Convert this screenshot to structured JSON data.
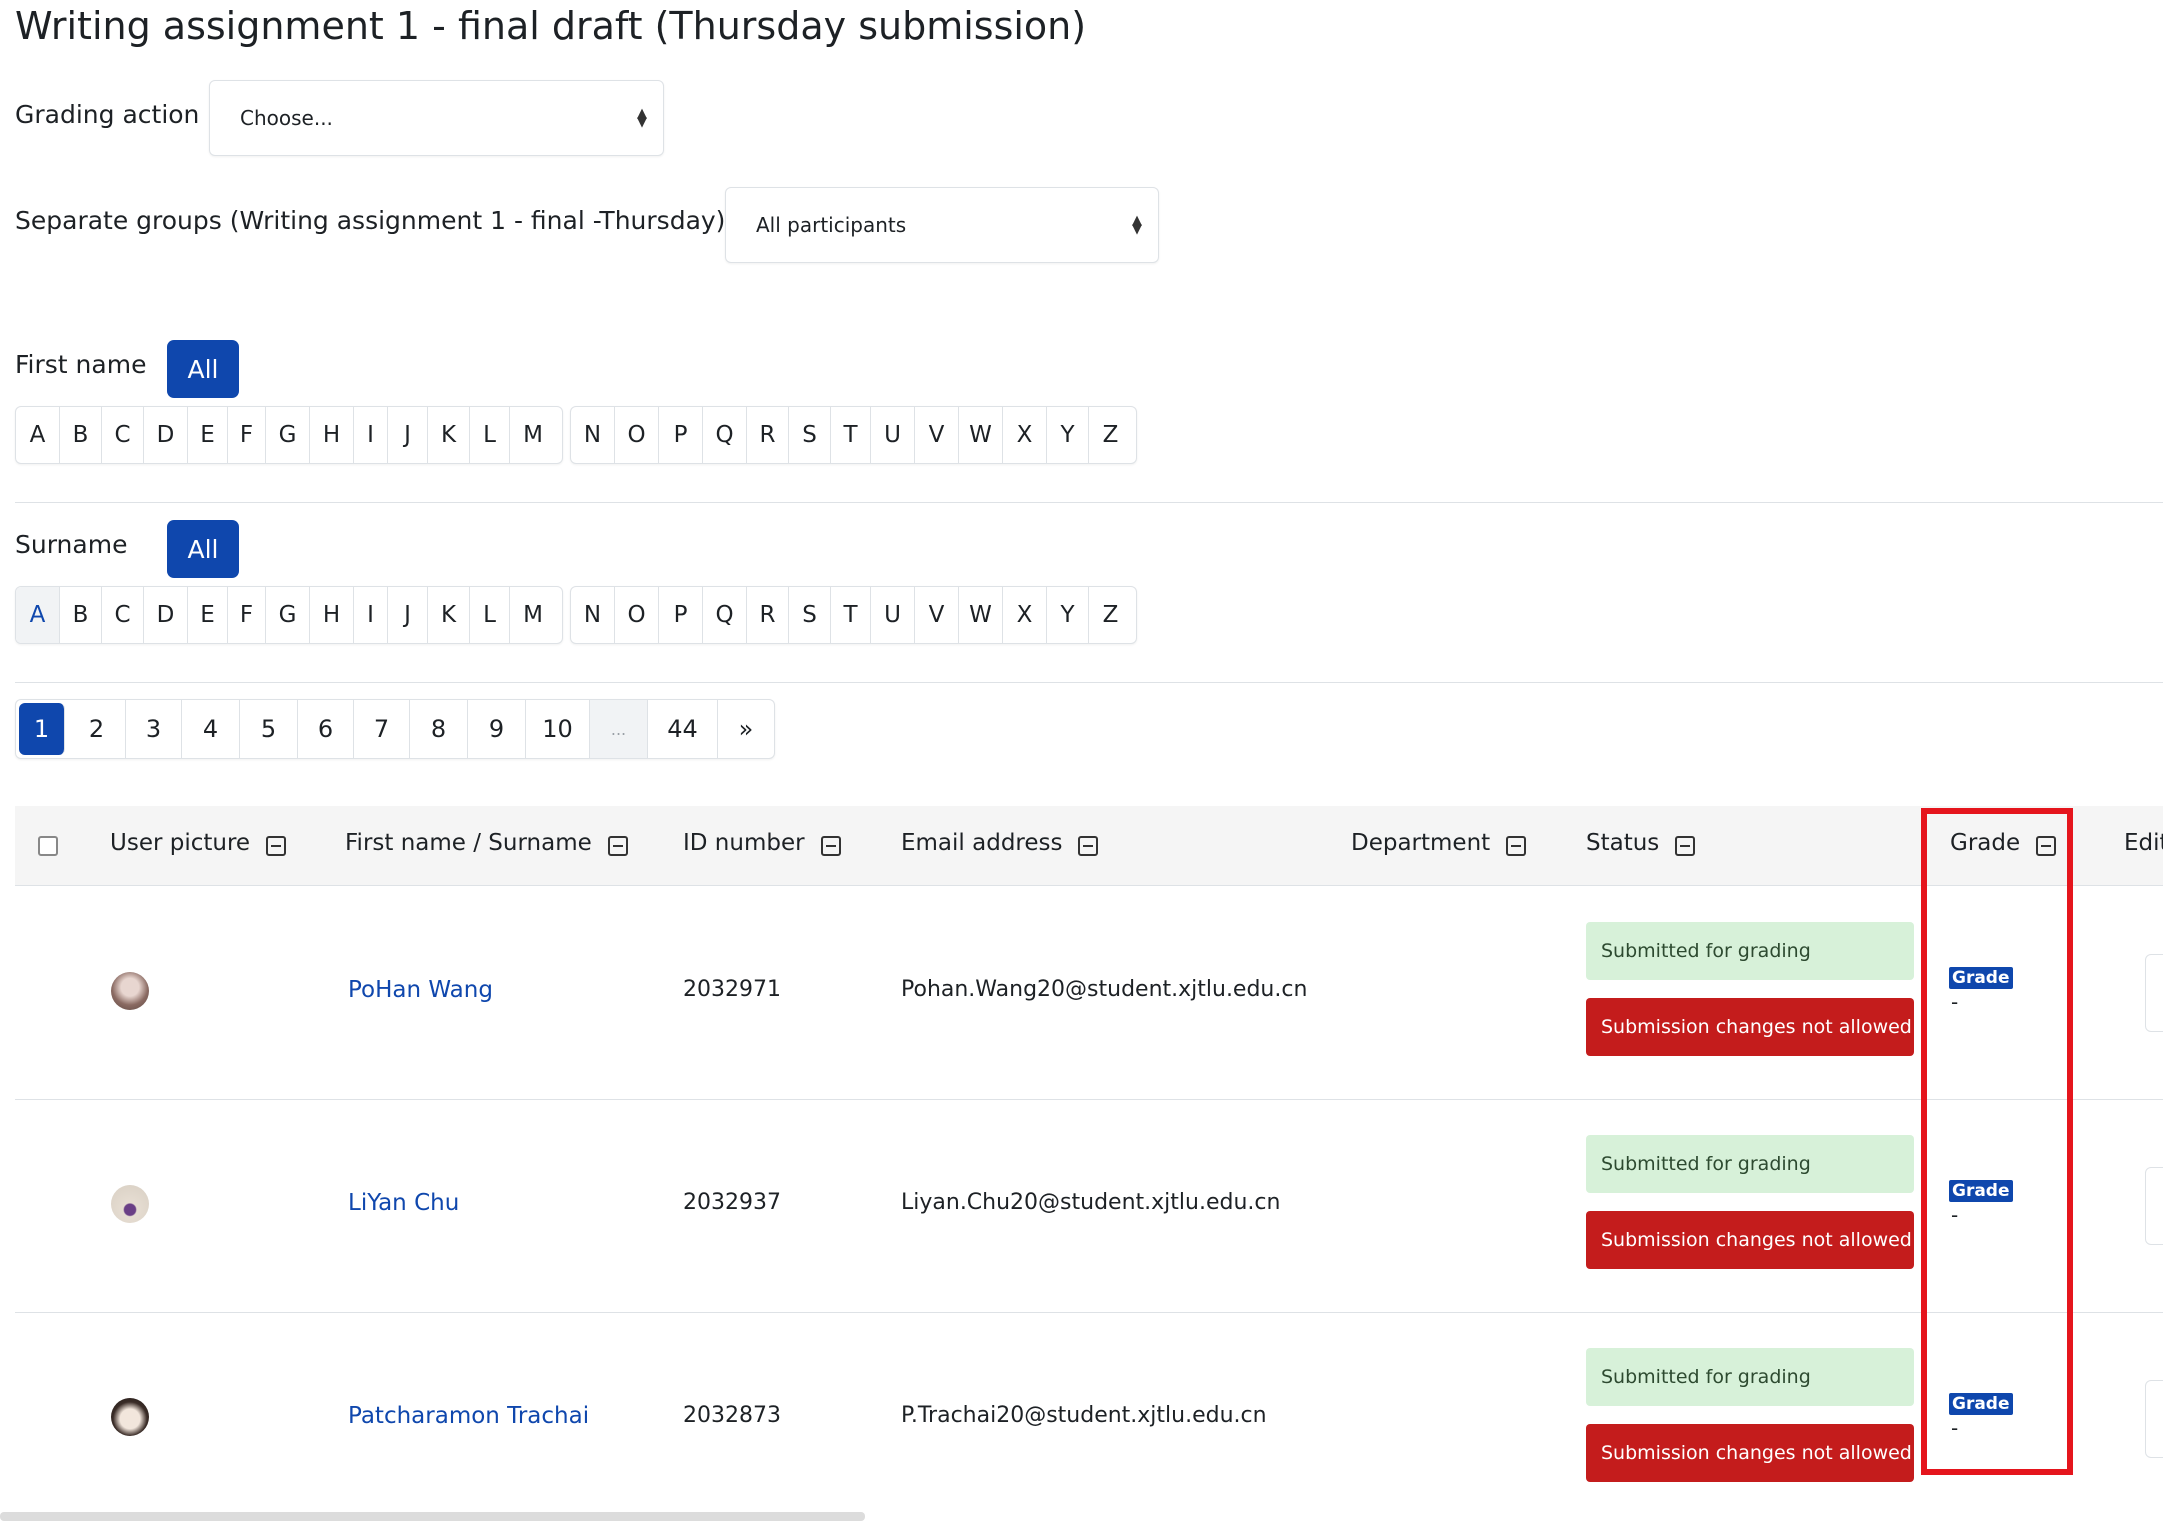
{
  "page_title": "Writing assignment 1 - final draft (Thursday submission)",
  "grading_action": {
    "label": "Grading action",
    "value": "Choose..."
  },
  "groups": {
    "label": "Separate groups (Writing assignment 1 - final -Thursday)",
    "value": "All participants"
  },
  "first_name_filter": {
    "label": "First name",
    "all_label": "All",
    "letters_a_m": [
      "A",
      "B",
      "C",
      "D",
      "E",
      "F",
      "G",
      "H",
      "I",
      "J",
      "K",
      "L",
      "M"
    ],
    "letters_n_z": [
      "N",
      "O",
      "P",
      "Q",
      "R",
      "S",
      "T",
      "U",
      "V",
      "W",
      "X",
      "Y",
      "Z"
    ]
  },
  "surname_filter": {
    "label": "Surname",
    "all_label": "All",
    "active_letter": "A",
    "letters_a_m": [
      "A",
      "B",
      "C",
      "D",
      "E",
      "F",
      "G",
      "H",
      "I",
      "J",
      "K",
      "L",
      "M"
    ],
    "letters_n_z": [
      "N",
      "O",
      "P",
      "Q",
      "R",
      "S",
      "T",
      "U",
      "V",
      "W",
      "X",
      "Y",
      "Z"
    ]
  },
  "pagination": {
    "pages": [
      "1",
      "2",
      "3",
      "4",
      "5",
      "6",
      "7",
      "8",
      "9",
      "10",
      "...",
      "44",
      "»"
    ],
    "current": "1"
  },
  "table": {
    "headers": {
      "user_picture": "User picture",
      "name": "First name / Surname",
      "id_number": "ID number",
      "email": "Email address",
      "department": "Department",
      "status": "Status",
      "grade": "Grade",
      "edit": "Edit"
    },
    "rows": [
      {
        "name": "PoHan Wang",
        "id_number": "2032971",
        "email": "Pohan.Wang20@student.xjtlu.edu.cn",
        "department": "",
        "status_submitted": "Submitted for grading",
        "status_locked": "Submission changes not allowed",
        "grade_label": "Grade",
        "grade_value": "-"
      },
      {
        "name": "LiYan Chu",
        "id_number": "2032937",
        "email": "Liyan.Chu20@student.xjtlu.edu.cn",
        "department": "",
        "status_submitted": "Submitted for grading",
        "status_locked": "Submission changes not allowed",
        "grade_label": "Grade",
        "grade_value": "-"
      },
      {
        "name": "Patcharamon Trachai",
        "id_number": "2032873",
        "email": "P.Trachai20@student.xjtlu.edu.cn",
        "department": "",
        "status_submitted": "Submitted for grading",
        "status_locked": "Submission changes not allowed",
        "grade_label": "Grade",
        "grade_value": "-"
      }
    ]
  },
  "colors": {
    "primary": "#0f47ad",
    "submitted_bg": "#d7f1d9",
    "locked_bg": "#c41c1c",
    "highlight": "#e5151d"
  }
}
